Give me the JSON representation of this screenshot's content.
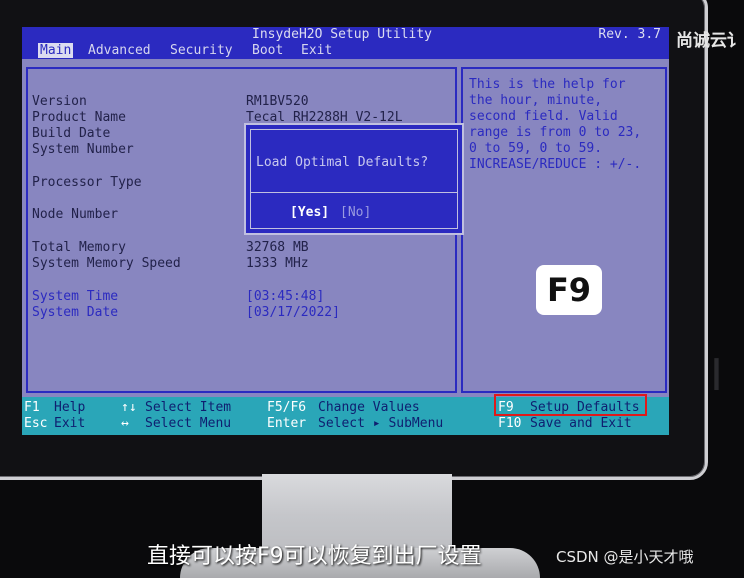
{
  "side_label": "尚诚云讠",
  "side_glyph": "I",
  "bios": {
    "title": "InsydeH2O Setup Utility",
    "rev": "Rev. 3.7",
    "menu": [
      "Main",
      "Advanced",
      "Security",
      "Boot",
      "Exit"
    ],
    "active_menu": "Main",
    "rows": [
      {
        "label": "Version",
        "value": "RM1BV520"
      },
      {
        "label": "Product Name",
        "value": "Tecal RH2288H V2-12L"
      },
      {
        "label": "Build Date",
        "value": ""
      },
      {
        "label": "System Number",
        "value": ""
      },
      {
        "label": "Processor Type",
        "value": ""
      },
      {
        "label": "Node Number",
        "value": ""
      },
      {
        "label": "Total Memory",
        "value": "32768 MB"
      },
      {
        "label": "System Memory Speed",
        "value": "1333 MHz"
      },
      {
        "label": "System Time",
        "value": "[03:45:48]"
      },
      {
        "label": "System Date",
        "value": "[03/17/2022]"
      }
    ],
    "help_text": "This is the help for\nthe hour, minute,\nsecond field. Valid\nrange is from 0 to 23,\n0 to 59, 0 to 59.\nINCREASE/REDUCE : +/-.",
    "dialog": {
      "prompt": "Load Optimal Defaults?",
      "yes": "[Yes]",
      "no": "[No]"
    },
    "footer": [
      {
        "key": "F1",
        "desc": "Help"
      },
      {
        "key": "Esc",
        "desc": "Exit"
      },
      {
        "key": "↑↓",
        "desc": "Select Item"
      },
      {
        "key": "↔",
        "desc": "Select Menu"
      },
      {
        "key": "F5/F6",
        "desc": "Change Values"
      },
      {
        "key": "Enter",
        "desc": "Select ▸ SubMenu"
      },
      {
        "key": "F9",
        "desc": "Setup Defaults"
      },
      {
        "key": "F10",
        "desc": "Save and Exit"
      }
    ]
  },
  "overlay_badge": "F9",
  "subtitle": "直接可以按F9可以恢复到出厂设置",
  "watermark": "CSDN @是小天才哦",
  "colors": {
    "bios_bg": "#8886c0",
    "bios_blue": "#2b2ac0",
    "footer_bg": "#2aa6b8",
    "highlight": "#e01a1a"
  }
}
